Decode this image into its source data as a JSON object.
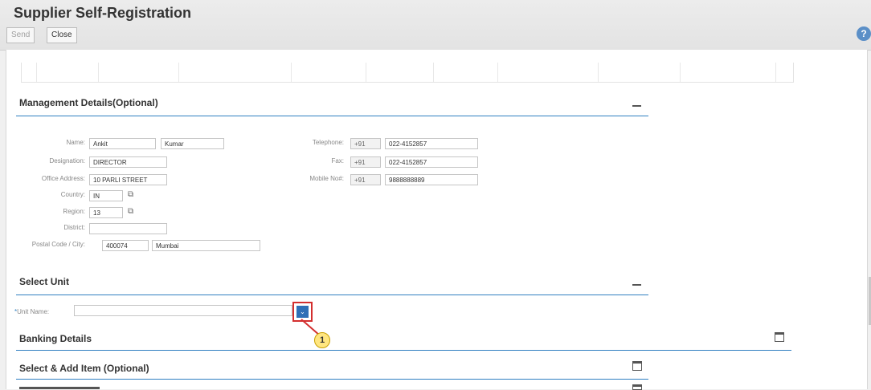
{
  "app": {
    "title": "Supplier Self-Registration",
    "buttons": {
      "send": "Send",
      "close": "Close"
    },
    "help": "?"
  },
  "management": {
    "title": "Management Details(Optional)",
    "labels": {
      "name": "Name:",
      "designation": "Designation:",
      "office_address": "Office Address:",
      "country": "Country:",
      "region": "Region:",
      "district": "District:",
      "postal_city": "Postal Code / City:",
      "telephone": "Telephone:",
      "fax": "Fax:",
      "mobile": "Mobile No#:"
    },
    "values": {
      "first_name": "Ankit",
      "last_name": "Kumar",
      "designation": "DIRECTOR",
      "office_address": "10 PARLI STREET",
      "country": "IN",
      "region": "13",
      "district": "",
      "postal_code": "400074",
      "city": "Mumbai",
      "tel_code": "+91",
      "telephone": "022-4152857",
      "fax_code": "+91",
      "fax": "022-4152857",
      "mobile_code": "+91",
      "mobile": "9888888889"
    }
  },
  "select_unit": {
    "title": "Select Unit",
    "required_marker": "*",
    "label": "Unit Name:",
    "value": ""
  },
  "banking": {
    "title": "Banking Details"
  },
  "select_add": {
    "title": "Select & Add Item (Optional)"
  },
  "annotation": {
    "step": "1"
  },
  "colors": {
    "accent": "#2f7fc1",
    "highlight": "#d32f2f",
    "callout": "#ffe680"
  }
}
